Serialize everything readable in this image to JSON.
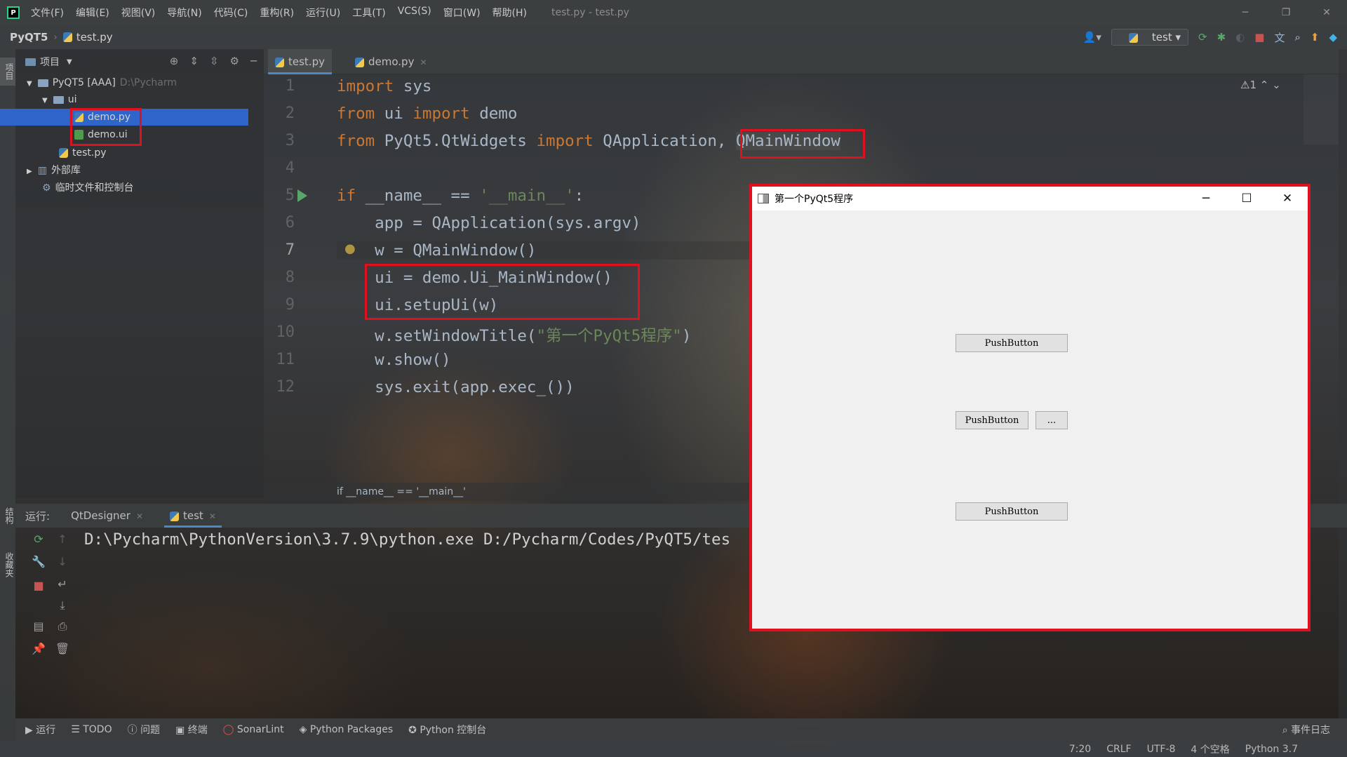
{
  "ide": {
    "window_title": "test.py - test.py",
    "menu": [
      "文件(F)",
      "编辑(E)",
      "视图(V)",
      "导航(N)",
      "代码(C)",
      "重构(R)",
      "运行(U)",
      "工具(T)",
      "VCS(S)",
      "窗口(W)",
      "帮助(H)"
    ],
    "breadcrumb": {
      "project": "PyQT5",
      "file": "test.py"
    },
    "run_config": "test"
  },
  "left_stripe": {
    "project_tab": "项目",
    "structure_tab": "结构",
    "favorites_tab": "收藏夹"
  },
  "project": {
    "header": "项目",
    "root": {
      "name": "PyQT5 [AAA]",
      "path": "D:\\Pycharm"
    },
    "folder_ui": "ui",
    "file_demo_py": "demo.py",
    "file_demo_ui": "demo.ui",
    "file_test_py": "test.py",
    "external_libs": "外部库",
    "scratches": "临时文件和控制台"
  },
  "editor": {
    "tabs": [
      "test.py",
      "demo.py"
    ],
    "line_numbers": [
      "1",
      "2",
      "3",
      "4",
      "5",
      "6",
      "7",
      "8",
      "9",
      "10",
      "11",
      "12"
    ],
    "inspection_count": "1",
    "breadcrumb": "if __name__ == '__main__'",
    "code": {
      "l1_kw": "import",
      "l1_rest": " sys",
      "l2_kw1": "from",
      "l2_mid": " ui ",
      "l2_kw2": "import",
      "l2_rest": " demo",
      "l3_kw1": "from",
      "l3_mid": " PyQt5.QtWidgets ",
      "l3_kw2": "import",
      "l3_rest": " QApplication, ",
      "l3_hl": "QMainWindow",
      "l5_kw": "if",
      "l5_mid": " __name__ == ",
      "l5_str": "'__main__'",
      "l5_end": ":",
      "l6": "    app = QApplication(sys.argv)",
      "l7": "    w = QMainWindow()",
      "l8": "    ui = demo.Ui_MainWindow()",
      "l9": "    ui.setupUi(w)",
      "l10_a": "    w.setWindowTitle(",
      "l10_str": "\"第一个PyQt5程序\"",
      "l10_b": ")",
      "l11": "    w.show()",
      "l12": "    sys.exit(app.exec_())"
    }
  },
  "run": {
    "label": "运行:",
    "tabs": [
      "QtDesigner",
      "test"
    ],
    "console": "D:\\Pycharm\\PythonVersion\\3.7.9\\python.exe D:/Pycharm/Codes/PyQT5/tes"
  },
  "toolwindows": [
    "运行",
    "TODO",
    "问题",
    "终端",
    "SonarLint",
    "Python Packages",
    "Python 控制台"
  ],
  "event_log": "事件日志",
  "status": {
    "position": "7:20",
    "line_sep": "CRLF",
    "encoding": "UTF-8",
    "indent": "4 个空格",
    "interpreter": "Python 3.7"
  },
  "qt_window": {
    "title": "第一个PyQt5程序",
    "button1": "PushButton",
    "button2": "PushButton",
    "button_dots": "...",
    "button3": "PushButton"
  },
  "colors": {
    "highlight_red": "#e0101e",
    "selection_blue": "#2f65ca",
    "keyword": "#cc7832",
    "string": "#6a8759"
  }
}
